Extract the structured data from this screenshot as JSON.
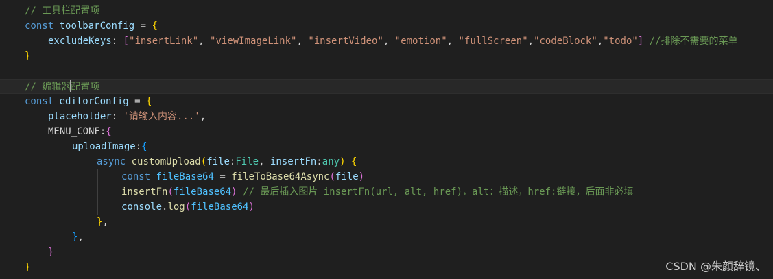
{
  "editor": {
    "l1": {
      "comment": "// 工具栏配置项"
    },
    "l2": {
      "kw": "const",
      "name": "toolbarConfig",
      "eq": " = ",
      "open": "{"
    },
    "l3": {
      "key": "excludeKeys",
      "colon": ": ",
      "lb": "[",
      "s1": "\"insertLink\"",
      "s2": "\"viewImageLink\"",
      "s3": "\"insertVideo\"",
      "s4": "\"emotion\"",
      "s5": "\"fullScreen\"",
      "s6": "\"codeBlock\"",
      "s7": "\"todo\"",
      "sep": ", ",
      "sepNoSpace": ",",
      "rb": "]",
      "comment": " //排除不需要的菜单"
    },
    "l4": {
      "close": "}"
    },
    "l6": {
      "commentA": "// 编辑器",
      "commentB": "配置项"
    },
    "l7": {
      "kw": "const",
      "name": "editorConfig",
      "eq": " = ",
      "open": "{"
    },
    "l8": {
      "key": "placeholder",
      "colon": ": ",
      "str": "'请输入内容...'",
      "comma": ","
    },
    "l9": {
      "key": "MENU_CONF",
      "colon": ":",
      "open": "{"
    },
    "l10": {
      "key": "uploadImage",
      "colon": ":",
      "open": "{"
    },
    "l11": {
      "async": "async",
      "fn": "customUpload",
      "lp": "(",
      "p1": "file",
      "c1": ":",
      "t1": "File",
      "sep": ", ",
      "p2": "insertFn",
      "c2": ":",
      "t2": "any",
      "rp": ")",
      "open": " {"
    },
    "l12": {
      "kw": "const",
      "name": "fileBase64",
      "eq": " = ",
      "fn": "fileToBase64Async",
      "lp": "(",
      "arg": "file",
      "rp": ")"
    },
    "l13": {
      "fn": "insertFn",
      "lp": "(",
      "arg": "fileBase64",
      "rp": ")",
      "comment": " // 最后插入图片 insertFn(url, alt, href)，alt：描述，href:链接，后面非必填"
    },
    "l14": {
      "obj": "console",
      "dot": ".",
      "fn": "log",
      "lp": "(",
      "arg": "fileBase64",
      "rp": ")"
    },
    "l15": {
      "close": "}",
      "comma": ","
    },
    "l16": {
      "close": "}",
      "comma": ","
    },
    "l17": {
      "close": "}"
    },
    "l18": {
      "close": "}"
    }
  },
  "watermark": "CSDN @朱颜辞镜、"
}
